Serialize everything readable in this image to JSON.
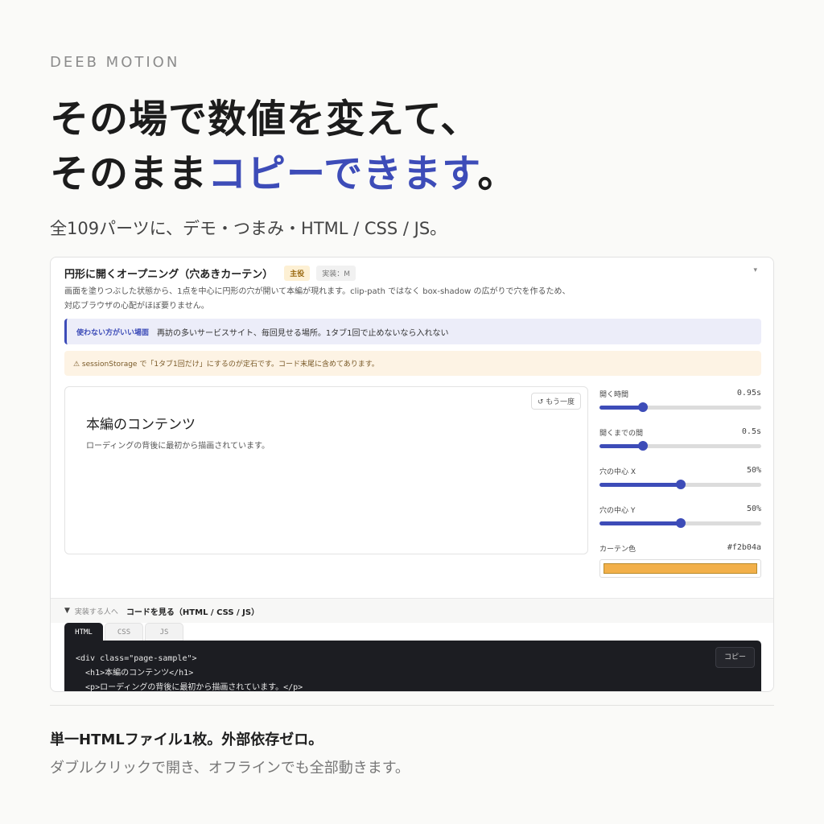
{
  "brand": "DEEB MOTION",
  "headline": {
    "line1": "その場で数値を変えて、",
    "line2_prefix": "そのまま",
    "line2_accent": "コピーできます",
    "line2_suffix": "。"
  },
  "subline": "全109パーツに、デモ・つまみ・HTML / CSS / JS。",
  "card": {
    "title": "円形に開くオープニング（穴あきカーテン）",
    "badge_main": "主役",
    "badge_impl": "実装：M",
    "collapse_icon": "▾",
    "desc_line1": "画面を塗りつぶした状態から、1点を中心に円形の穴が開いて本編が現れます。clip-path ではなく box-shadow の広がりで穴を作るため、",
    "desc_line2": "対応ブラウザの心配がほぼ要りません。",
    "note_blue_tag": "使わない方がいい場面",
    "note_blue_text": "再訪の多いサービスサイト、毎回見せる場所。1タブ1回で止めないなら入れない",
    "note_orange": "⚠ sessionStorage で「1タブ1回だけ」にするのが定石です。コード末尾に含めてあります。",
    "demo": {
      "replay": "↺ もう一度",
      "h1": "本編のコンテンツ",
      "p": "ローディングの背後に最初から描画されています。"
    },
    "controls": [
      {
        "label": "開く時間",
        "value": "0.95s",
        "fraction": 0.27
      },
      {
        "label": "開くまでの間",
        "value": "0.5s",
        "fraction": 0.27
      },
      {
        "label": "穴の中心 X",
        "value": "50%",
        "fraction": 0.5
      },
      {
        "label": "穴の中心 Y",
        "value": "50%",
        "fraction": 0.5
      }
    ],
    "color_control": {
      "label": "カーテン色",
      "value": "#f2b04a",
      "swatch": "#f2b04a"
    },
    "code_bar": {
      "caret": "▼",
      "who": "実装する人へ",
      "label": "コードを見る（HTML / CSS / JS）"
    },
    "tabs": [
      "HTML",
      "CSS",
      "JS"
    ],
    "code_lines": [
      "<div class=\"page-sample\">",
      "  <h1>本編のコンテンツ</h1>",
      "  <p>ローディングの背後に最初から描画されています。</p>"
    ],
    "copy": "コピー"
  },
  "footer": {
    "line1": "単一HTMLファイル1枚。外部依存ゼロ。",
    "line2": "ダブルクリックで開き、オフラインでも全部動きます。"
  },
  "colors": {
    "accent": "#3d4cb8",
    "curtain": "#f2b04a"
  }
}
